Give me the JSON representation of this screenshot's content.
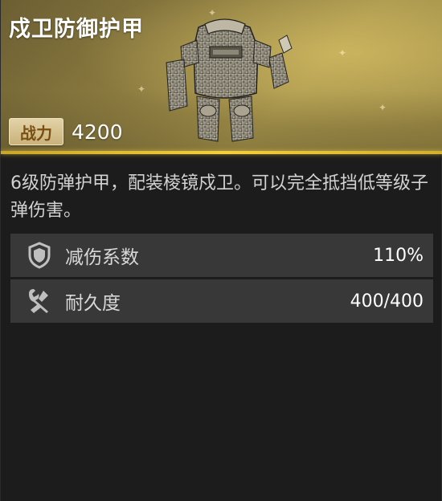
{
  "item": {
    "name": "戍卫防御护甲",
    "power_label": "战力",
    "power_value": "4200",
    "icon": "armor-suit-image"
  },
  "description": "6级防弹护甲，配装棱镜戍卫。可以完全抵挡低等级子弹伤害。",
  "stats": [
    {
      "icon": "shield-icon",
      "label": "减伤系数",
      "value": "110%"
    },
    {
      "icon": "wrench-icon",
      "label": "耐久度",
      "value": "400/400"
    }
  ],
  "colors": {
    "header_gold": "#a8954c",
    "accent_line": "#f5cf3c",
    "panel_bg": "#1c1c1c",
    "stat_row_bg": "#383838"
  }
}
